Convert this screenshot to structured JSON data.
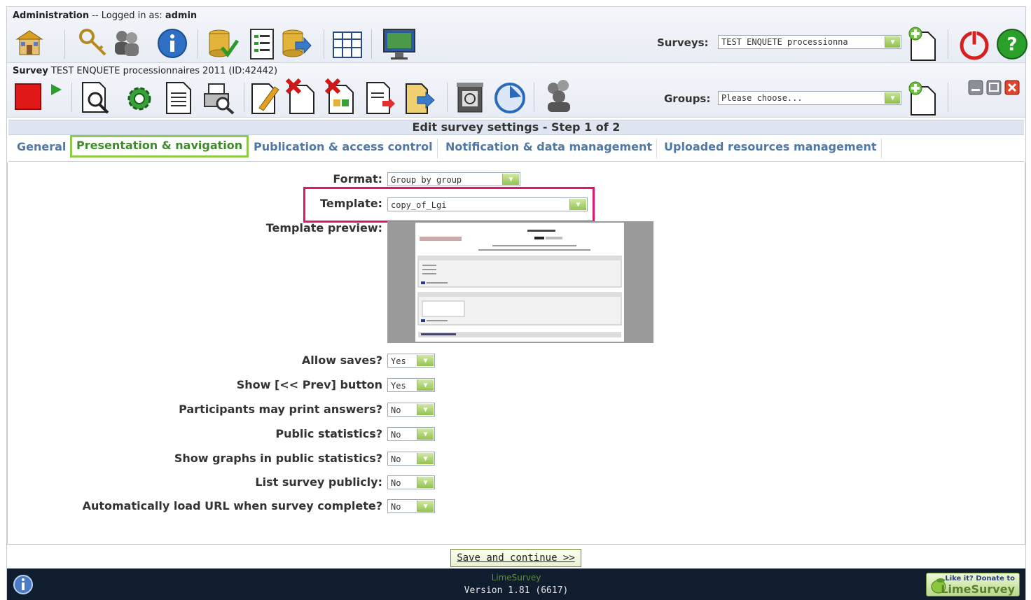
{
  "admin_bar": {
    "title_bold": "Administration",
    "title_rest": " -- Logged in as: ",
    "user": "admin",
    "surveys_label": "Surveys:",
    "surveys_selected": "TEST ENQUETE processionna"
  },
  "survey_bar": {
    "title_bold": "Survey",
    "title_rest": " TEST ENQUETE processionnaires 2011 (ID:42442)",
    "groups_label": "Groups:",
    "groups_selected": "Please choose..."
  },
  "step_header": "Edit survey settings - Step 1 of 2",
  "tabs": [
    {
      "label": "General"
    },
    {
      "label": "Presentation & navigation",
      "active": true
    },
    {
      "label": "Publication & access control"
    },
    {
      "label": "Notification & data management"
    },
    {
      "label": "Uploaded resources management"
    }
  ],
  "form": {
    "format_label": "Format:",
    "format_value": "Group by group",
    "template_label": "Template:",
    "template_value": "copy_of_Lgi",
    "preview_label": "Template preview:",
    "fields": [
      {
        "label": "Allow saves?",
        "value": "Yes"
      },
      {
        "label": "Show [<< Prev] button",
        "value": "Yes"
      },
      {
        "label": "Participants may print answers?",
        "value": "No"
      },
      {
        "label": "Public statistics?",
        "value": "No"
      },
      {
        "label": "Show graphs in public statistics?",
        "value": "No"
      },
      {
        "label": "List survey publicly:",
        "value": "No"
      },
      {
        "label": "Automatically load URL when survey complete?",
        "value": "No"
      }
    ]
  },
  "save_button": "Save and continue >>",
  "footer": {
    "brand": "LimeSurvey",
    "version": "Version 1.81 (6617)",
    "donate_line1": "Like it? Donate to",
    "donate_line2": "LimeSurvey"
  },
  "icons": {
    "admin_toolbar": [
      "home-icon",
      "keys-icon",
      "users-icon",
      "info-icon",
      "database-check-icon",
      "document-list-icon",
      "database-export-icon",
      "grid-icon",
      "screen-icon",
      "add-survey-icon",
      "power-icon",
      "help-icon"
    ],
    "survey_toolbar": [
      "stop-icon",
      "play-icon",
      "preview-icon",
      "settings-gear-icon",
      "document-icon",
      "print-preview-icon",
      "edit-icon",
      "delete-doc-icon",
      "delete-responses-icon",
      "export-doc-icon",
      "import-icon",
      "tokens-icon",
      "timer-icon",
      "users-group-icon",
      "add-group-icon"
    ]
  },
  "colors": {
    "active_tab_border": "#8ecb4b",
    "highlight_border": "#e0156e",
    "tab_text": "#4f78a6",
    "footer_bg": "#0f1d2e"
  }
}
